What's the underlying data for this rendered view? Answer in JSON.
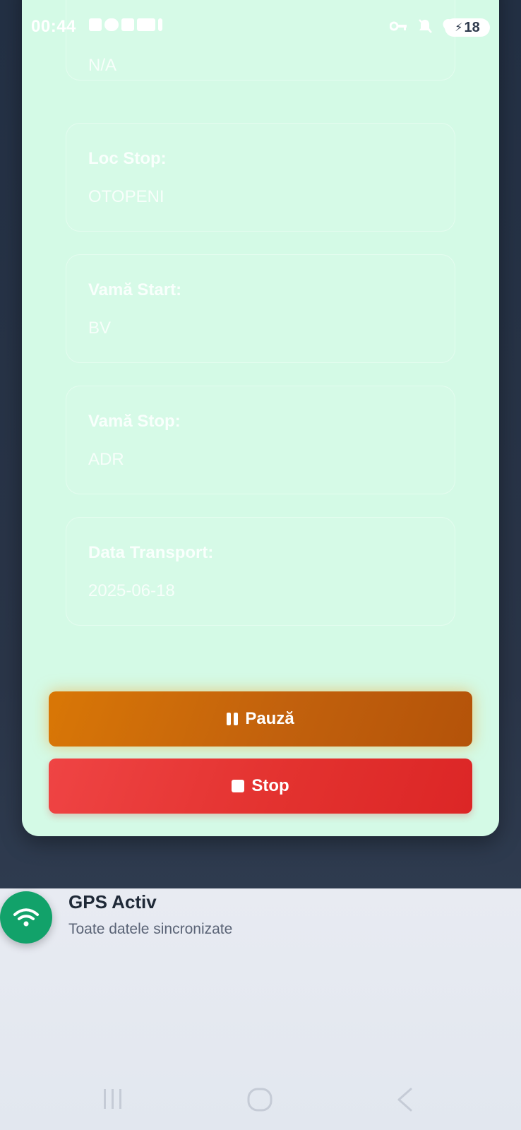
{
  "status_bar": {
    "time": "00:44",
    "battery": "18"
  },
  "details": {
    "fields": [
      {
        "label": "",
        "value": "N/A"
      },
      {
        "label": "Loc Stop:",
        "value": "OTOPENI"
      },
      {
        "label": "Vamă Start:",
        "value": "BV"
      },
      {
        "label": "Vamă Stop:",
        "value": "ADR"
      },
      {
        "label": "Data Transport:",
        "value": "2025-06-18"
      }
    ]
  },
  "actions": {
    "pause_label": "Pauză",
    "stop_label": "Stop"
  },
  "gps_status": {
    "title": "GPS Activ",
    "subtitle": "Toate datele sincronizate"
  },
  "colors": {
    "card_bg": "#d4fae6",
    "pause_button": "#c2610d",
    "stop_button": "#e3322f",
    "gps_badge": "#12a26a"
  },
  "icons": [
    "pause-icon",
    "stop-icon",
    "wifi-icon",
    "recents-icon",
    "home-icon",
    "back-icon"
  ]
}
